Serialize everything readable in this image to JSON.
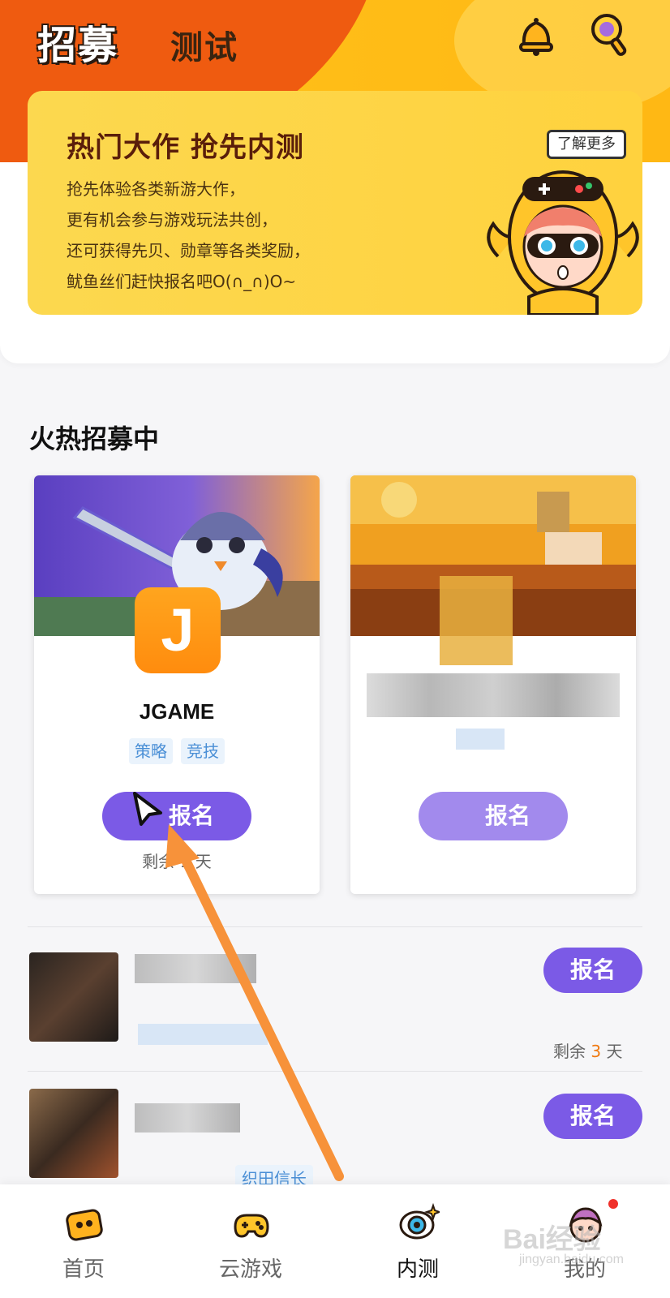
{
  "header": {
    "tab_active": "招募",
    "tab_other": "测试",
    "bell_icon": "bell-icon",
    "search_icon": "search-icon"
  },
  "banner": {
    "title": "热门大作 抢先内测",
    "lines": [
      "抢先体验各类新游大作，",
      "更有机会参与游戏玩法共创，",
      "还可获得先贝、勋章等各类奖励，",
      "鱿鱼丝们赶快报名吧O(∩_∩)O~"
    ],
    "learn_more": "了解更多"
  },
  "section": {
    "title": "火热招募中"
  },
  "cards": [
    {
      "logo_letter": "J",
      "name": "JGAME",
      "tags": [
        "策略",
        "竞技"
      ],
      "enroll": "报名",
      "remaining": "剩余 1 天"
    },
    {
      "enroll": "报名",
      "remaining": ""
    }
  ],
  "list": [
    {
      "enroll": "报名",
      "remaining_prefix": "剩余",
      "remaining_num": "3",
      "remaining_suffix": "天"
    },
    {
      "enroll": "报名",
      "tag": "织田信长"
    }
  ],
  "bottom_nav": [
    {
      "label": "首页",
      "icon": "home-game-icon"
    },
    {
      "label": "云游戏",
      "icon": "cloud-gamepad-icon"
    },
    {
      "label": "内测",
      "icon": "eye-icon",
      "active": true
    },
    {
      "label": "我的",
      "icon": "profile-mascot-icon",
      "badge": true
    }
  ],
  "watermark": {
    "text": "Bai经验",
    "sub": "jingyan.baidu.com"
  },
  "colors": {
    "accent_purple": "#7b5ae6",
    "brand_orange": "#ef5b10",
    "banner_yellow": "#fcd84f",
    "tag_blue": "#4a8fd6",
    "annotation_arrow": "#f7923a"
  }
}
